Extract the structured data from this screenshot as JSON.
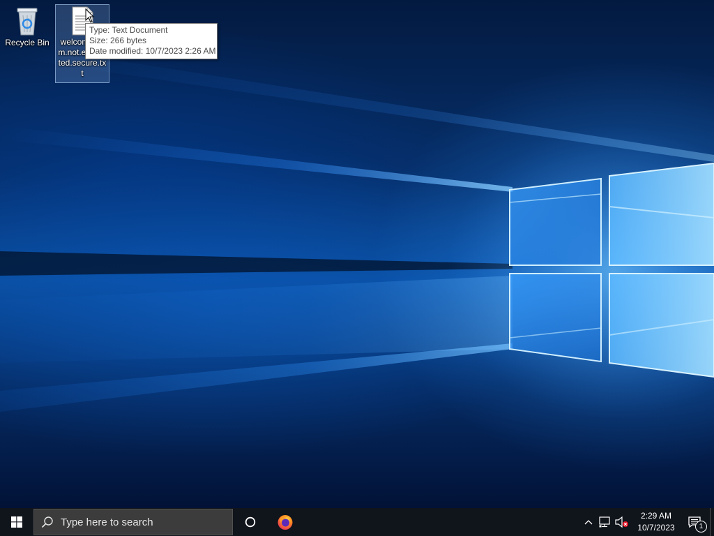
{
  "desktop": {
    "icons": [
      {
        "label": "Recycle Bin",
        "icon": "recycle-bin-icon"
      },
      {
        "label": "welcome.cvm.not.encrypted.secure.txt",
        "icon": "text-document-icon",
        "selected": true
      }
    ],
    "tooltip": {
      "type": "Type: Text Document",
      "size": "Size: 266 bytes",
      "modified": "Date modified: 10/7/2023 2:26 AM"
    }
  },
  "taskbar": {
    "start_icon": "windows-logo-icon",
    "search_placeholder": "Type here to search",
    "cortana_icon": "cortana-circle-icon",
    "pinned": [
      {
        "name": "Firefox",
        "icon": "firefox-icon"
      }
    ],
    "tray": {
      "chevron_icon": "chevron-up-icon",
      "network_icon": "network-icon",
      "volume_icon": "volume-muted-icon"
    },
    "clock": {
      "time": "2:29 AM",
      "date": "10/7/2023"
    },
    "notifications": {
      "icon": "action-center-icon",
      "count": "1"
    }
  },
  "colors": {
    "taskbar": "#10141b",
    "search_box": "#3c3c3c",
    "wallpaper_light": "#7fc8ff",
    "wallpaper_dark": "#02122c"
  }
}
